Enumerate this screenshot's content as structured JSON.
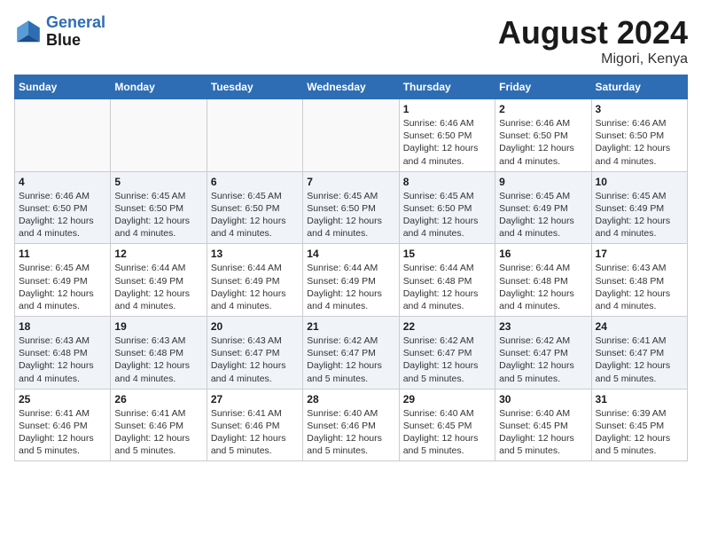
{
  "header": {
    "logo_line1": "General",
    "logo_line2": "Blue",
    "month": "August 2024",
    "location": "Migori, Kenya"
  },
  "weekdays": [
    "Sunday",
    "Monday",
    "Tuesday",
    "Wednesday",
    "Thursday",
    "Friday",
    "Saturday"
  ],
  "weeks": [
    [
      {
        "day": "",
        "info": ""
      },
      {
        "day": "",
        "info": ""
      },
      {
        "day": "",
        "info": ""
      },
      {
        "day": "",
        "info": ""
      },
      {
        "day": "1",
        "info": "Sunrise: 6:46 AM\nSunset: 6:50 PM\nDaylight: 12 hours and 4 minutes."
      },
      {
        "day": "2",
        "info": "Sunrise: 6:46 AM\nSunset: 6:50 PM\nDaylight: 12 hours and 4 minutes."
      },
      {
        "day": "3",
        "info": "Sunrise: 6:46 AM\nSunset: 6:50 PM\nDaylight: 12 hours and 4 minutes."
      }
    ],
    [
      {
        "day": "4",
        "info": "Sunrise: 6:46 AM\nSunset: 6:50 PM\nDaylight: 12 hours and 4 minutes."
      },
      {
        "day": "5",
        "info": "Sunrise: 6:45 AM\nSunset: 6:50 PM\nDaylight: 12 hours and 4 minutes."
      },
      {
        "day": "6",
        "info": "Sunrise: 6:45 AM\nSunset: 6:50 PM\nDaylight: 12 hours and 4 minutes."
      },
      {
        "day": "7",
        "info": "Sunrise: 6:45 AM\nSunset: 6:50 PM\nDaylight: 12 hours and 4 minutes."
      },
      {
        "day": "8",
        "info": "Sunrise: 6:45 AM\nSunset: 6:50 PM\nDaylight: 12 hours and 4 minutes."
      },
      {
        "day": "9",
        "info": "Sunrise: 6:45 AM\nSunset: 6:49 PM\nDaylight: 12 hours and 4 minutes."
      },
      {
        "day": "10",
        "info": "Sunrise: 6:45 AM\nSunset: 6:49 PM\nDaylight: 12 hours and 4 minutes."
      }
    ],
    [
      {
        "day": "11",
        "info": "Sunrise: 6:45 AM\nSunset: 6:49 PM\nDaylight: 12 hours and 4 minutes."
      },
      {
        "day": "12",
        "info": "Sunrise: 6:44 AM\nSunset: 6:49 PM\nDaylight: 12 hours and 4 minutes."
      },
      {
        "day": "13",
        "info": "Sunrise: 6:44 AM\nSunset: 6:49 PM\nDaylight: 12 hours and 4 minutes."
      },
      {
        "day": "14",
        "info": "Sunrise: 6:44 AM\nSunset: 6:49 PM\nDaylight: 12 hours and 4 minutes."
      },
      {
        "day": "15",
        "info": "Sunrise: 6:44 AM\nSunset: 6:48 PM\nDaylight: 12 hours and 4 minutes."
      },
      {
        "day": "16",
        "info": "Sunrise: 6:44 AM\nSunset: 6:48 PM\nDaylight: 12 hours and 4 minutes."
      },
      {
        "day": "17",
        "info": "Sunrise: 6:43 AM\nSunset: 6:48 PM\nDaylight: 12 hours and 4 minutes."
      }
    ],
    [
      {
        "day": "18",
        "info": "Sunrise: 6:43 AM\nSunset: 6:48 PM\nDaylight: 12 hours and 4 minutes."
      },
      {
        "day": "19",
        "info": "Sunrise: 6:43 AM\nSunset: 6:48 PM\nDaylight: 12 hours and 4 minutes."
      },
      {
        "day": "20",
        "info": "Sunrise: 6:43 AM\nSunset: 6:47 PM\nDaylight: 12 hours and 4 minutes."
      },
      {
        "day": "21",
        "info": "Sunrise: 6:42 AM\nSunset: 6:47 PM\nDaylight: 12 hours and 5 minutes."
      },
      {
        "day": "22",
        "info": "Sunrise: 6:42 AM\nSunset: 6:47 PM\nDaylight: 12 hours and 5 minutes."
      },
      {
        "day": "23",
        "info": "Sunrise: 6:42 AM\nSunset: 6:47 PM\nDaylight: 12 hours and 5 minutes."
      },
      {
        "day": "24",
        "info": "Sunrise: 6:41 AM\nSunset: 6:47 PM\nDaylight: 12 hours and 5 minutes."
      }
    ],
    [
      {
        "day": "25",
        "info": "Sunrise: 6:41 AM\nSunset: 6:46 PM\nDaylight: 12 hours and 5 minutes."
      },
      {
        "day": "26",
        "info": "Sunrise: 6:41 AM\nSunset: 6:46 PM\nDaylight: 12 hours and 5 minutes."
      },
      {
        "day": "27",
        "info": "Sunrise: 6:41 AM\nSunset: 6:46 PM\nDaylight: 12 hours and 5 minutes."
      },
      {
        "day": "28",
        "info": "Sunrise: 6:40 AM\nSunset: 6:46 PM\nDaylight: 12 hours and 5 minutes."
      },
      {
        "day": "29",
        "info": "Sunrise: 6:40 AM\nSunset: 6:45 PM\nDaylight: 12 hours and 5 minutes."
      },
      {
        "day": "30",
        "info": "Sunrise: 6:40 AM\nSunset: 6:45 PM\nDaylight: 12 hours and 5 minutes."
      },
      {
        "day": "31",
        "info": "Sunrise: 6:39 AM\nSunset: 6:45 PM\nDaylight: 12 hours and 5 minutes."
      }
    ]
  ]
}
